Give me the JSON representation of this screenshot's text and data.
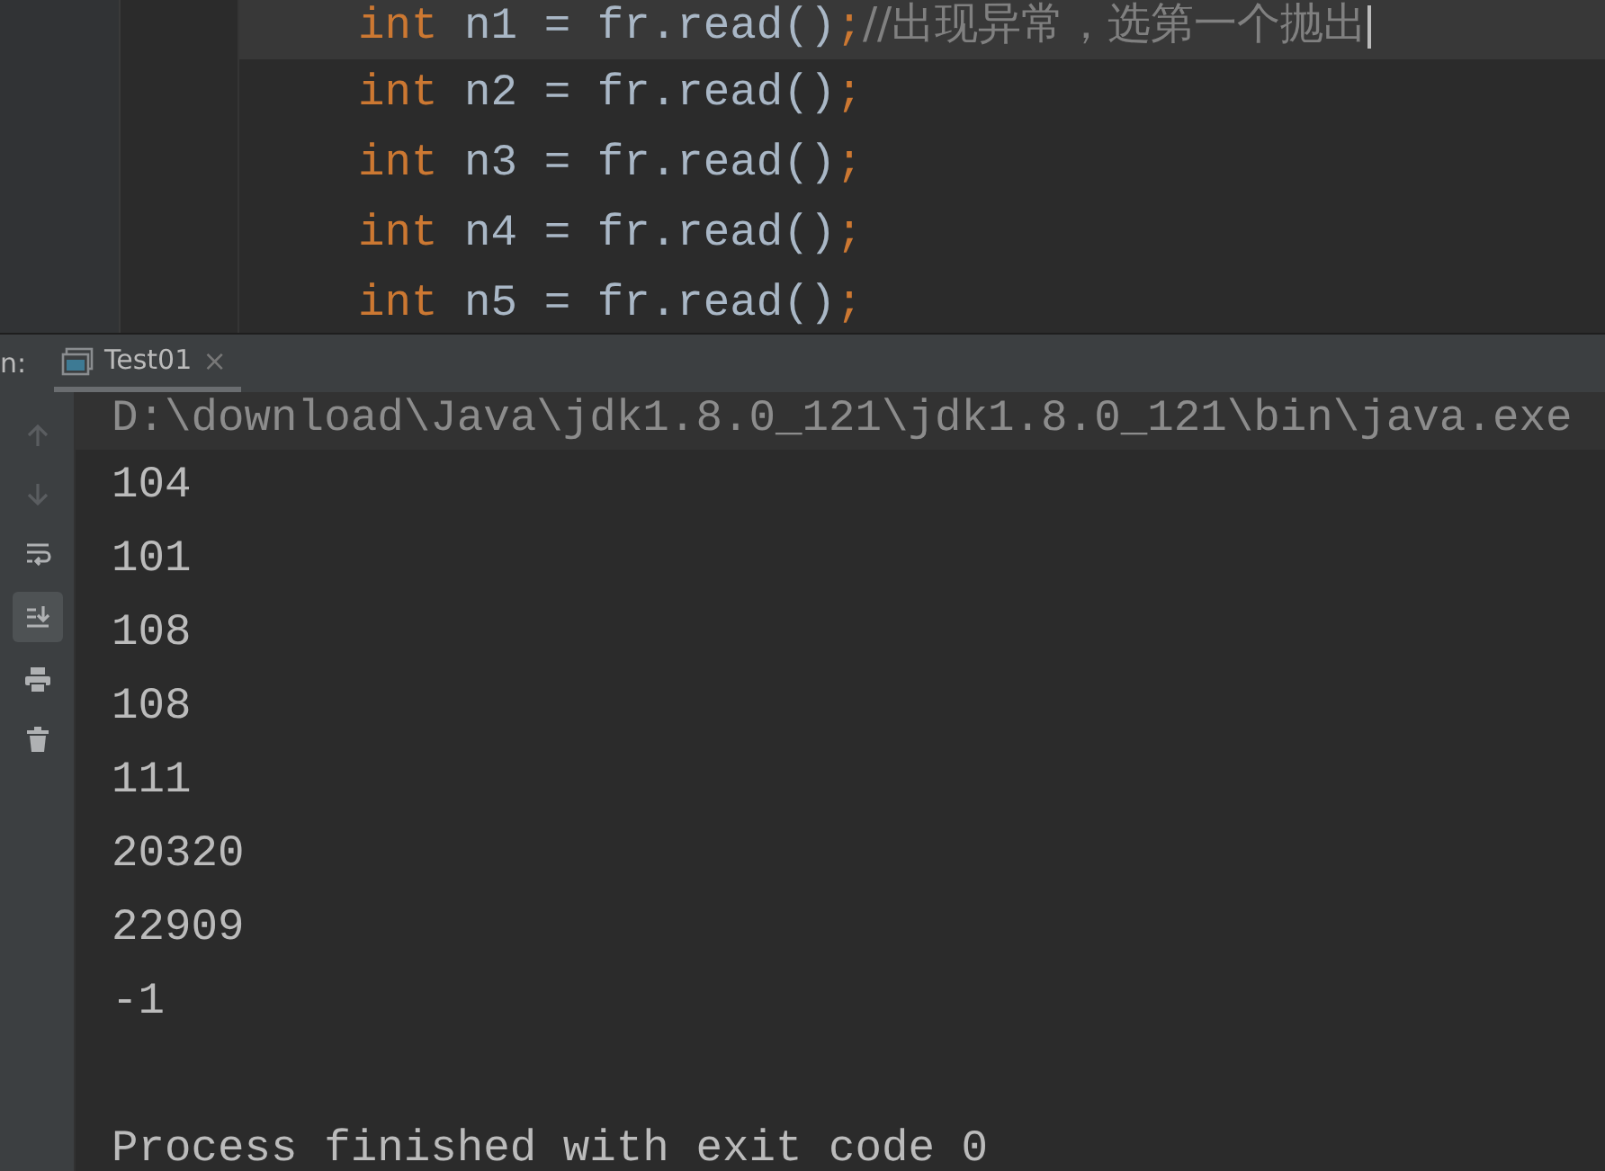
{
  "editor": {
    "lines": [
      {
        "current": true,
        "caret": true,
        "tokens": [
          {
            "text": "int",
            "kind": "keyword"
          },
          {
            "text": " n1 = fr.read()",
            "kind": "plain"
          },
          {
            "text": ";",
            "kind": "punct"
          },
          {
            "text": "//出现异常，选第一个抛出",
            "kind": "comment"
          }
        ]
      },
      {
        "current": false,
        "caret": false,
        "tokens": [
          {
            "text": "int",
            "kind": "keyword"
          },
          {
            "text": " n2 = fr.read()",
            "kind": "plain"
          },
          {
            "text": ";",
            "kind": "punct"
          }
        ]
      },
      {
        "current": false,
        "caret": false,
        "tokens": [
          {
            "text": "int",
            "kind": "keyword"
          },
          {
            "text": " n3 = fr.read()",
            "kind": "plain"
          },
          {
            "text": ";",
            "kind": "punct"
          }
        ]
      },
      {
        "current": false,
        "caret": false,
        "tokens": [
          {
            "text": "int",
            "kind": "keyword"
          },
          {
            "text": " n4 = fr.read()",
            "kind": "plain"
          },
          {
            "text": ";",
            "kind": "punct"
          }
        ]
      },
      {
        "current": false,
        "caret": false,
        "tokens": [
          {
            "text": "int",
            "kind": "keyword"
          },
          {
            "text": " n5 = fr.read()",
            "kind": "plain"
          },
          {
            "text": ";",
            "kind": "punct"
          }
        ]
      }
    ]
  },
  "run_panel": {
    "label": "n:",
    "tabs": [
      {
        "label": "Test01",
        "selected": true,
        "close": "×"
      }
    ],
    "toolbar": [
      {
        "kind": "up",
        "disabled": true,
        "on": false
      },
      {
        "kind": "down",
        "disabled": true,
        "on": false
      },
      {
        "kind": "wrap",
        "disabled": false,
        "on": false
      },
      {
        "kind": "scroll-end",
        "disabled": false,
        "on": true
      },
      {
        "kind": "print",
        "disabled": false,
        "on": false
      },
      {
        "kind": "trash",
        "disabled": false,
        "on": false
      }
    ],
    "console": [
      {
        "kind": "command",
        "text": "D:\\download\\Java\\jdk1.8.0_121\\jdk1.8.0_121\\bin\\java.exe"
      },
      {
        "kind": "output",
        "text": "104"
      },
      {
        "kind": "output",
        "text": "101"
      },
      {
        "kind": "output",
        "text": "108"
      },
      {
        "kind": "output",
        "text": "108"
      },
      {
        "kind": "output",
        "text": "111"
      },
      {
        "kind": "output",
        "text": "20320"
      },
      {
        "kind": "output",
        "text": "22909"
      },
      {
        "kind": "output",
        "text": "-1"
      },
      {
        "kind": "blank"
      },
      {
        "kind": "output",
        "text": "Process finished with exit code 0"
      }
    ]
  }
}
